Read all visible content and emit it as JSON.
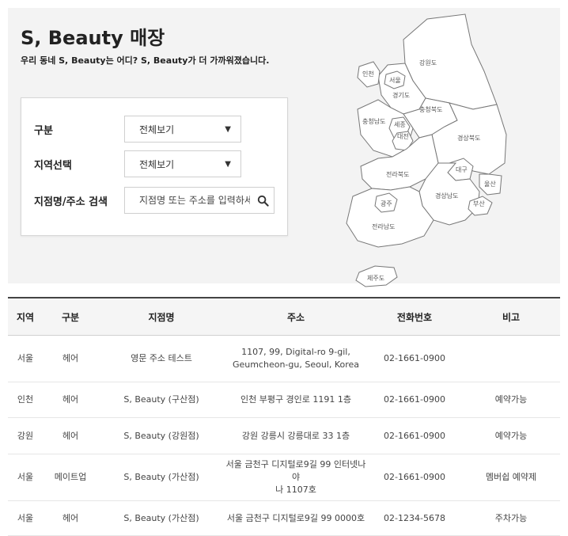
{
  "header": {
    "title": "S, Beauty 매장",
    "subtitle": "우리 동네 S, Beauty는 어디? S, Beauty가 더 가까워졌습니다."
  },
  "filters": {
    "category_label": "구분",
    "category_value": "전체보기",
    "region_label": "지역선택",
    "region_value": "전체보기",
    "search_label": "지점명/주소 검색",
    "search_placeholder": "지점명 또는 주소를 입력하세요"
  },
  "map": {
    "regions": {
      "incheon": "인천",
      "seoul": "서울",
      "gyeonggi": "경기도",
      "gangwon": "강원도",
      "chungbuk": "충청북도",
      "chungnam": "충청남도",
      "sejong": "세종",
      "daejeon": "대전",
      "gyeongbuk": "경상북도",
      "daegu": "대구",
      "jeonbuk": "전라북도",
      "ulsan": "울산",
      "gyeongnam": "경상남도",
      "busan": "부산",
      "gwangju": "광주",
      "jeonnam": "전라남도",
      "jeju": "제주도"
    }
  },
  "table": {
    "headers": [
      "지역",
      "구분",
      "지점명",
      "주소",
      "전화번호",
      "비고"
    ],
    "rows": [
      {
        "region": "서울",
        "type": "헤어",
        "branch": "영문 주소 테스트",
        "address_line1": "1107, 99, Digital-ro 9-gil,",
        "address_line2": "Geumcheon-gu, Seoul, Korea",
        "phone": "02-1661-0900",
        "note": ""
      },
      {
        "region": "인천",
        "type": "헤어",
        "branch": "S, Beauty (구산점)",
        "address_line1": "인천 부평구 경인로 1191 1층",
        "address_line2": "",
        "phone": "02-1661-0900",
        "note": "예약가능"
      },
      {
        "region": "강원",
        "type": "헤어",
        "branch": "S, Beauty (강원점)",
        "address_line1": "강원 강릉시 강릉대로 33 1층",
        "address_line2": "",
        "phone": "02-1661-0900",
        "note": "예약가능"
      },
      {
        "region": "서울",
        "type": "메이트업",
        "branch": "S, Beauty (가산점)",
        "address_line1": "서울 금천구 디지털로9길 99 인터넷나야",
        "address_line2": "나 1107호",
        "phone": "02-1661-0900",
        "note": "멤버쉽 예약제"
      },
      {
        "region": "서울",
        "type": "헤어",
        "branch": "S, Beauty (가산점)",
        "address_line1": "서울 금천구 디지털로9길 99 0000호",
        "address_line2": "",
        "phone": "02-1234-5678",
        "note": "주차가능"
      }
    ]
  }
}
